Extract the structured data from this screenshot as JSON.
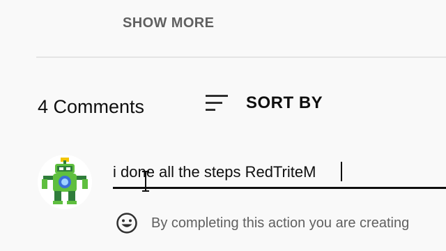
{
  "description": {
    "show_more_label": "SHOW MORE"
  },
  "comments": {
    "count_label": "4 Comments",
    "sort_label": "SORT BY",
    "sort_icon": "sort-icon"
  },
  "comment_box": {
    "avatar_icon": "avatar-robot-character",
    "value": "i done all the steps RedTriteM",
    "emoji_icon": "smiley-face-icon",
    "disclaimer": "By completing this action you are creating"
  },
  "colors": {
    "background": "#f9f9f9",
    "primary_text": "#0f0f0f",
    "secondary_text": "#606060",
    "divider": "#e4e4e4"
  }
}
